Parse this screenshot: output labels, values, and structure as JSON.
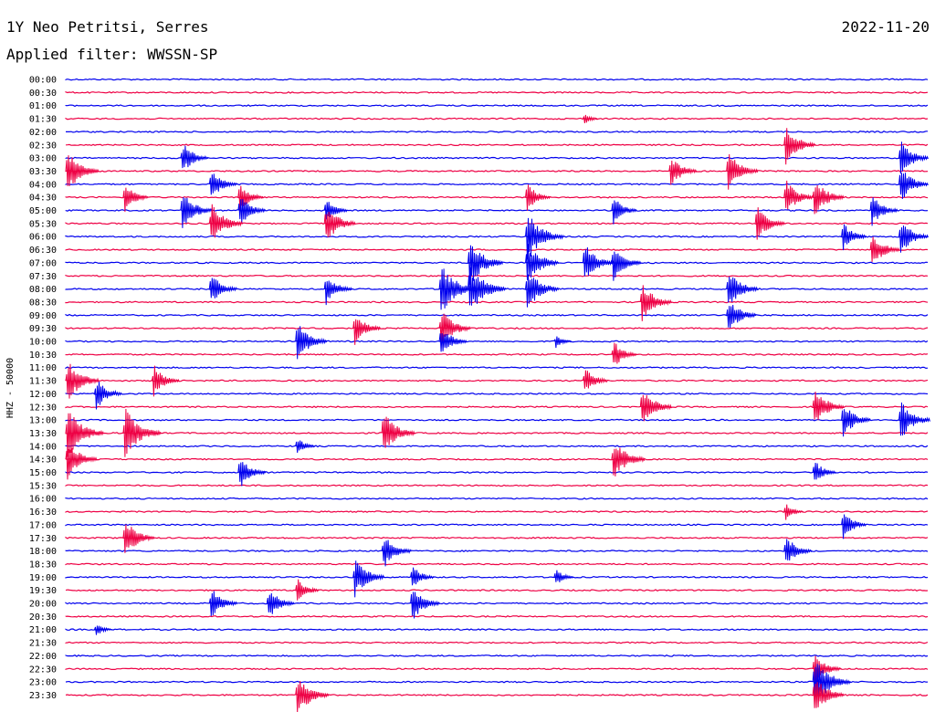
{
  "header": {
    "station": "1Y Neo Petritsi, Serres",
    "date": "2022-11-20",
    "filter": "Applied filter: WWSSN-SP"
  },
  "colors": {
    "even_hour": "#0000ee",
    "half_hour": "#ee0044"
  },
  "chart_data": {
    "type": "line",
    "title": "1Y Neo Petritsi, Serres",
    "ylabel": "HHZ - 50000",
    "rows": [
      "00:00",
      "00:30",
      "01:00",
      "01:30",
      "02:00",
      "02:30",
      "03:00",
      "03:30",
      "04:00",
      "04:30",
      "05:00",
      "05:30",
      "06:00",
      "06:30",
      "07:00",
      "07:30",
      "08:00",
      "08:30",
      "09:00",
      "09:30",
      "10:00",
      "10:30",
      "11:00",
      "11:30",
      "12:00",
      "12:30",
      "13:00",
      "13:30",
      "14:00",
      "14:30",
      "15:00",
      "15:30",
      "16:00",
      "16:30",
      "17:00",
      "17:30",
      "18:00",
      "18:30",
      "19:00",
      "19:30",
      "20:00",
      "20:30",
      "21:00",
      "21:30",
      "22:00",
      "22:30",
      "23:00",
      "23:30"
    ],
    "bursts": [
      {
        "row": "01:30",
        "minute": 18,
        "amp": 0.4
      },
      {
        "row": "02:30",
        "minute": 25,
        "amp": 1.2
      },
      {
        "row": "03:00",
        "minute": 4,
        "amp": 1.0
      },
      {
        "row": "03:00",
        "minute": 29,
        "amp": 1.1
      },
      {
        "row": "03:30",
        "minute": 0,
        "amp": 1.3
      },
      {
        "row": "03:30",
        "minute": 21,
        "amp": 1.0
      },
      {
        "row": "03:30",
        "minute": 23,
        "amp": 1.2
      },
      {
        "row": "04:00",
        "minute": 5,
        "amp": 1.0
      },
      {
        "row": "04:00",
        "minute": 29,
        "amp": 1.1
      },
      {
        "row": "04:30",
        "minute": 2,
        "amp": 0.9
      },
      {
        "row": "04:30",
        "minute": 6,
        "amp": 0.9
      },
      {
        "row": "04:30",
        "minute": 16,
        "amp": 0.9
      },
      {
        "row": "04:30",
        "minute": 25,
        "amp": 1.1
      },
      {
        "row": "04:30",
        "minute": 26,
        "amp": 1.2
      },
      {
        "row": "05:00",
        "minute": 4,
        "amp": 1.2
      },
      {
        "row": "05:00",
        "minute": 6,
        "amp": 1.0
      },
      {
        "row": "05:00",
        "minute": 9,
        "amp": 0.8
      },
      {
        "row": "05:00",
        "minute": 19,
        "amp": 0.9
      },
      {
        "row": "05:00",
        "minute": 28,
        "amp": 1.0
      },
      {
        "row": "05:30",
        "minute": 5,
        "amp": 1.3
      },
      {
        "row": "05:30",
        "minute": 9,
        "amp": 1.2
      },
      {
        "row": "05:30",
        "minute": 24,
        "amp": 1.1
      },
      {
        "row": "06:00",
        "minute": 16,
        "amp": 1.5
      },
      {
        "row": "06:00",
        "minute": 27,
        "amp": 0.9
      },
      {
        "row": "06:00",
        "minute": 29,
        "amp": 1.1
      },
      {
        "row": "06:30",
        "minute": 28,
        "amp": 1.1
      },
      {
        "row": "07:00",
        "minute": 14,
        "amp": 1.4
      },
      {
        "row": "07:00",
        "minute": 16,
        "amp": 1.3
      },
      {
        "row": "07:00",
        "minute": 18,
        "amp": 1.2
      },
      {
        "row": "07:00",
        "minute": 19,
        "amp": 1.1
      },
      {
        "row": "08:00",
        "minute": 5,
        "amp": 1.0
      },
      {
        "row": "08:00",
        "minute": 9,
        "amp": 1.0
      },
      {
        "row": "08:00",
        "minute": 13,
        "amp": 1.5
      },
      {
        "row": "08:00",
        "minute": 14,
        "amp": 1.5
      },
      {
        "row": "08:00",
        "minute": 16,
        "amp": 1.3
      },
      {
        "row": "08:00",
        "minute": 23,
        "amp": 1.2
      },
      {
        "row": "08:30",
        "minute": 20,
        "amp": 1.2
      },
      {
        "row": "09:00",
        "minute": 23,
        "amp": 1.1
      },
      {
        "row": "09:30",
        "minute": 10,
        "amp": 1.0
      },
      {
        "row": "09:30",
        "minute": 13,
        "amp": 1.2
      },
      {
        "row": "10:00",
        "minute": 8,
        "amp": 1.2
      },
      {
        "row": "10:00",
        "minute": 13,
        "amp": 1.0
      },
      {
        "row": "10:00",
        "minute": 17,
        "amp": 0.5
      },
      {
        "row": "10:30",
        "minute": 19,
        "amp": 0.9
      },
      {
        "row": "11:30",
        "minute": 0,
        "amp": 1.3
      },
      {
        "row": "11:30",
        "minute": 3,
        "amp": 1.0
      },
      {
        "row": "11:30",
        "minute": 18,
        "amp": 0.9
      },
      {
        "row": "12:00",
        "minute": 1,
        "amp": 1.0
      },
      {
        "row": "12:30",
        "minute": 20,
        "amp": 1.2
      },
      {
        "row": "12:30",
        "minute": 26,
        "amp": 1.2
      },
      {
        "row": "13:00",
        "minute": 27,
        "amp": 1.1
      },
      {
        "row": "13:00",
        "minute": 29,
        "amp": 1.2
      },
      {
        "row": "13:30",
        "minute": 0,
        "amp": 1.5
      },
      {
        "row": "13:30",
        "minute": 2,
        "amp": 1.5
      },
      {
        "row": "13:30",
        "minute": 11,
        "amp": 1.3
      },
      {
        "row": "14:00",
        "minute": 8,
        "amp": 0.6
      },
      {
        "row": "14:30",
        "minute": 0,
        "amp": 1.2
      },
      {
        "row": "14:30",
        "minute": 19,
        "amp": 1.3
      },
      {
        "row": "15:00",
        "minute": 6,
        "amp": 1.0
      },
      {
        "row": "15:00",
        "minute": 26,
        "amp": 0.8
      },
      {
        "row": "16:30",
        "minute": 25,
        "amp": 0.6
      },
      {
        "row": "17:00",
        "minute": 27,
        "amp": 0.9
      },
      {
        "row": "17:30",
        "minute": 2,
        "amp": 1.2
      },
      {
        "row": "18:00",
        "minute": 11,
        "amp": 1.1
      },
      {
        "row": "18:00",
        "minute": 25,
        "amp": 1.0
      },
      {
        "row": "19:00",
        "minute": 10,
        "amp": 1.2
      },
      {
        "row": "19:00",
        "minute": 12,
        "amp": 0.8
      },
      {
        "row": "19:00",
        "minute": 17,
        "amp": 0.6
      },
      {
        "row": "19:30",
        "minute": 8,
        "amp": 0.8
      },
      {
        "row": "20:00",
        "minute": 5,
        "amp": 1.0
      },
      {
        "row": "20:00",
        "minute": 7,
        "amp": 1.0
      },
      {
        "row": "20:00",
        "minute": 12,
        "amp": 1.1
      },
      {
        "row": "21:00",
        "minute": 1,
        "amp": 0.5
      },
      {
        "row": "22:30",
        "minute": 26,
        "amp": 1.0
      },
      {
        "row": "23:00",
        "minute": 26,
        "amp": 1.5
      },
      {
        "row": "23:30",
        "minute": 8,
        "amp": 1.3
      },
      {
        "row": "23:30",
        "minute": 26,
        "amp": 1.2
      }
    ]
  }
}
